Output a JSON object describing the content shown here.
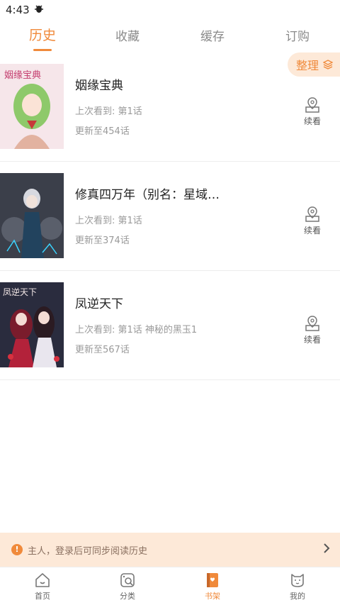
{
  "status_bar": {
    "time": "4:43",
    "notification_icon": "bug-icon"
  },
  "tabs": [
    {
      "label": "历史",
      "active": true
    },
    {
      "label": "收藏",
      "active": false
    },
    {
      "label": "缓存",
      "active": false
    },
    {
      "label": "订购",
      "active": false
    }
  ],
  "organize": {
    "label": "整理",
    "icon": "layers-icon"
  },
  "comics": [
    {
      "title": "姻缘宝典",
      "last_read": "上次看到: 第1话",
      "update": "更新至454话",
      "continue_label": "续看",
      "cover_text": "姻缘宝典"
    },
    {
      "title": "修真四万年（别名：星域…",
      "last_read": "上次看到: 第1话",
      "update": "更新至374话",
      "continue_label": "续看",
      "cover_text": ""
    },
    {
      "title": "凤逆天下",
      "last_read": "上次看到: 第1话 神秘的黑玉1",
      "update": "更新至567话",
      "continue_label": "续看",
      "cover_text": "凤逆天下"
    }
  ],
  "login_prompt": {
    "text": "主人，登录后可同步阅读历史"
  },
  "bottom_nav": [
    {
      "label": "首页",
      "icon": "home-icon",
      "active": false
    },
    {
      "label": "分类",
      "icon": "category-icon",
      "active": false
    },
    {
      "label": "书架",
      "icon": "bookshelf-icon",
      "active": true
    },
    {
      "label": "我的",
      "icon": "profile-icon",
      "active": false
    }
  ],
  "colors": {
    "accent": "#f08a3b",
    "accent_light": "#fde9d8"
  }
}
